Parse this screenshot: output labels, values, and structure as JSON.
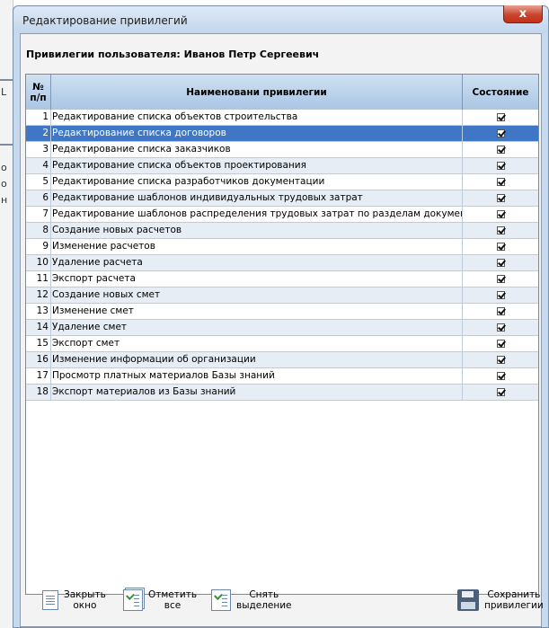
{
  "window": {
    "title": "Редактирование привилегий",
    "close_label": "x"
  },
  "user_label": "Привилегии пользователя: Иванов Петр Сергеевич",
  "table": {
    "headers": {
      "num": "№\nп/п",
      "name": "Наименовани привилегии",
      "state": "Состояние"
    },
    "selected_row": 2,
    "rows": [
      {
        "num": "1",
        "name": "Редактирование списка объектов строительства",
        "checked": true
      },
      {
        "num": "2",
        "name": "Редактирование списка договоров",
        "checked": true
      },
      {
        "num": "3",
        "name": "Редактирование списка заказчиков",
        "checked": true
      },
      {
        "num": "4",
        "name": "Редактирование списка объектов проектирования",
        "checked": true
      },
      {
        "num": "5",
        "name": "Редактирование списка разработчиков документации",
        "checked": true
      },
      {
        "num": "6",
        "name": "Редактирование шаблонов индивидуальных трудовых затрат",
        "checked": true
      },
      {
        "num": "7",
        "name": "Редактирование шаблонов распределения трудовых затрат по разделам документации",
        "checked": true
      },
      {
        "num": "8",
        "name": "Создание новых расчетов",
        "checked": true
      },
      {
        "num": "9",
        "name": "Изменение расчетов",
        "checked": true
      },
      {
        "num": "10",
        "name": "Удаление расчета",
        "checked": true
      },
      {
        "num": "11",
        "name": "Экспорт расчета",
        "checked": true
      },
      {
        "num": "12",
        "name": "Создание новых смет",
        "checked": true
      },
      {
        "num": "13",
        "name": "Изменение смет",
        "checked": true
      },
      {
        "num": "14",
        "name": "Удаление смет",
        "checked": true
      },
      {
        "num": "15",
        "name": "Экспорт смет",
        "checked": true
      },
      {
        "num": "16",
        "name": "Изменение информации об организации",
        "checked": true
      },
      {
        "num": "17",
        "name": "Просмотр платных материалов Базы знаний",
        "checked": true
      },
      {
        "num": "18",
        "name": "Экспорт материалов из Базы знаний",
        "checked": true
      }
    ]
  },
  "toolbar": {
    "close": {
      "line1": "Закрыть",
      "line2": "окно",
      "icon": "document-icon"
    },
    "check_all": {
      "line1": "Отметить",
      "line2": "все",
      "icon": "check-all-icon"
    },
    "uncheck": {
      "line1": "Снять",
      "line2": "выделение",
      "icon": "checklist-icon"
    },
    "save": {
      "line1": "Сохранить",
      "line2": "привилегии",
      "icon": "floppy-disk-icon"
    }
  },
  "background": {
    "chars": [
      "L",
      "o",
      "o",
      "н"
    ]
  },
  "colors": {
    "selection": "#3f77c6",
    "header": "#b8d0ea",
    "frame": "#c7d9ee"
  }
}
